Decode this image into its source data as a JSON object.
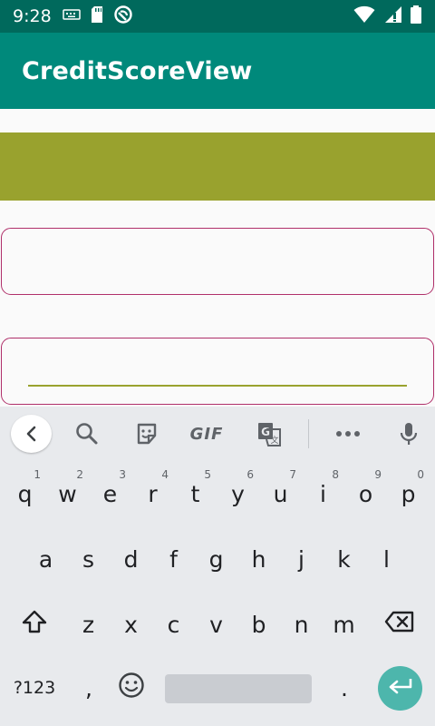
{
  "status_bar": {
    "time": "9:28",
    "left_icons": [
      "keyboard-icon",
      "sd-card-icon",
      "do-not-disturb-icon"
    ],
    "right_icons": [
      "wifi-icon",
      "signal-icon",
      "battery-icon"
    ]
  },
  "app_bar": {
    "title": "CreditScoreView"
  },
  "colors": {
    "status_bar": "#00695c",
    "app_bar": "#00897b",
    "banner": "#99a22e",
    "field_border": "#b0306a",
    "enter_key": "#4db6ac"
  },
  "form": {
    "field1_value": "",
    "field2_value": ""
  },
  "keyboard": {
    "toolbar": [
      "back-chevron-icon",
      "search-icon",
      "sticker-icon",
      "GIF",
      "translate-icon",
      "more-icon",
      "mic-icon"
    ],
    "row1": [
      {
        "key": "q",
        "hint": "1"
      },
      {
        "key": "w",
        "hint": "2"
      },
      {
        "key": "e",
        "hint": "3"
      },
      {
        "key": "r",
        "hint": "4"
      },
      {
        "key": "t",
        "hint": "5"
      },
      {
        "key": "y",
        "hint": "6"
      },
      {
        "key": "u",
        "hint": "7"
      },
      {
        "key": "i",
        "hint": "8"
      },
      {
        "key": "o",
        "hint": "9"
      },
      {
        "key": "p",
        "hint": "0"
      }
    ],
    "row2": [
      "a",
      "s",
      "d",
      "f",
      "g",
      "h",
      "j",
      "k",
      "l"
    ],
    "row3": [
      "z",
      "x",
      "c",
      "v",
      "b",
      "n",
      "m"
    ],
    "symbols_label": "?123",
    "comma": ",",
    "period": "."
  }
}
